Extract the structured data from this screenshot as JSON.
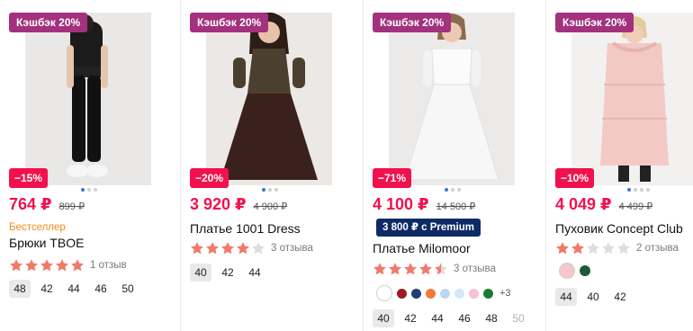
{
  "products": [
    {
      "cashback": "Кэшбэк 20%",
      "discount": "−15%",
      "price": "764 ₽",
      "old_price": "899 ₽",
      "label": "Бестселлер",
      "title": "Брюки TBOE",
      "rating": 5,
      "reviews": "1 отзыв",
      "sizes": [
        "48",
        "42",
        "44",
        "46",
        "50"
      ],
      "selected_size": "48"
    },
    {
      "cashback": "Кэшбэк 20%",
      "discount": "−20%",
      "price": "3 920 ₽",
      "old_price": "4 900 ₽",
      "title": "Платье 1001 Dress",
      "rating": 4,
      "reviews": "3 отзыва",
      "sizes": [
        "40",
        "42",
        "44"
      ],
      "selected_size": "40"
    },
    {
      "cashback": "Кэшбэк 20%",
      "discount": "−71%",
      "price": "4 100 ₽",
      "old_price": "14 500 ₽",
      "premium": "3 800 ₽ с Premium",
      "title": "Платье Milomoor",
      "rating": 4.5,
      "reviews": "3 отзыва",
      "colors": [
        "#ffffff",
        "#9e1b24",
        "#1f3f7a",
        "#f07c3c",
        "#b9d9f2",
        "#d3e7f9",
        "#f7c1d4",
        "#1a7a31"
      ],
      "more_colors": "+3",
      "sizes": [
        "40",
        "42",
        "44",
        "46",
        "48",
        "50"
      ],
      "selected_size": "40",
      "unavailable": [
        "50"
      ]
    },
    {
      "cashback": "Кэшбэк 20%",
      "discount": "−10%",
      "price": "4 049 ₽",
      "old_price": "4 499 ₽",
      "title": "Пуховик Concept Club",
      "rating": 2,
      "reviews": "2 отзыва",
      "colors": [
        "#f6c6cf",
        "#1d5a38"
      ],
      "sizes": [
        "44",
        "40",
        "42"
      ],
      "selected_size": "44"
    }
  ]
}
